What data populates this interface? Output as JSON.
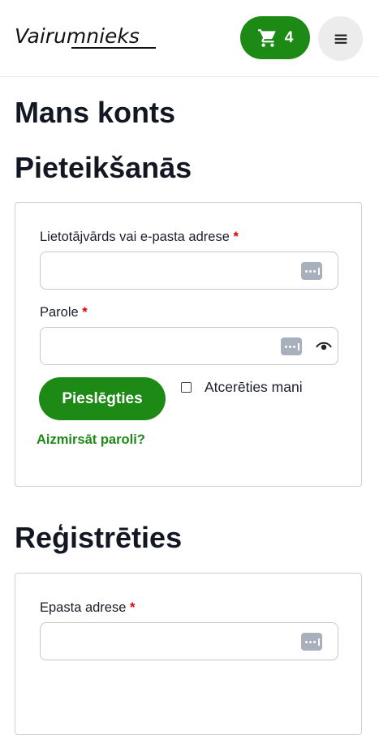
{
  "header": {
    "logo_text": "Vairumnieks",
    "cart_count": "4"
  },
  "page_title": "Mans konts",
  "login": {
    "heading": "Pieteikšanās",
    "username_label": "Lietotājvārds vai e-pasta adrese",
    "password_label": "Parole",
    "required_mark": "*",
    "login_button": "Pieslēgties",
    "remember_label": "Atcerēties mani",
    "forgot_link": "Aizmirsāt paroli?"
  },
  "register": {
    "heading": "Reģistrēties",
    "email_label": "Epasta adrese",
    "required_mark": "*"
  },
  "colors": {
    "brand_green": "#1d8a16",
    "required_red": "#e00000"
  }
}
